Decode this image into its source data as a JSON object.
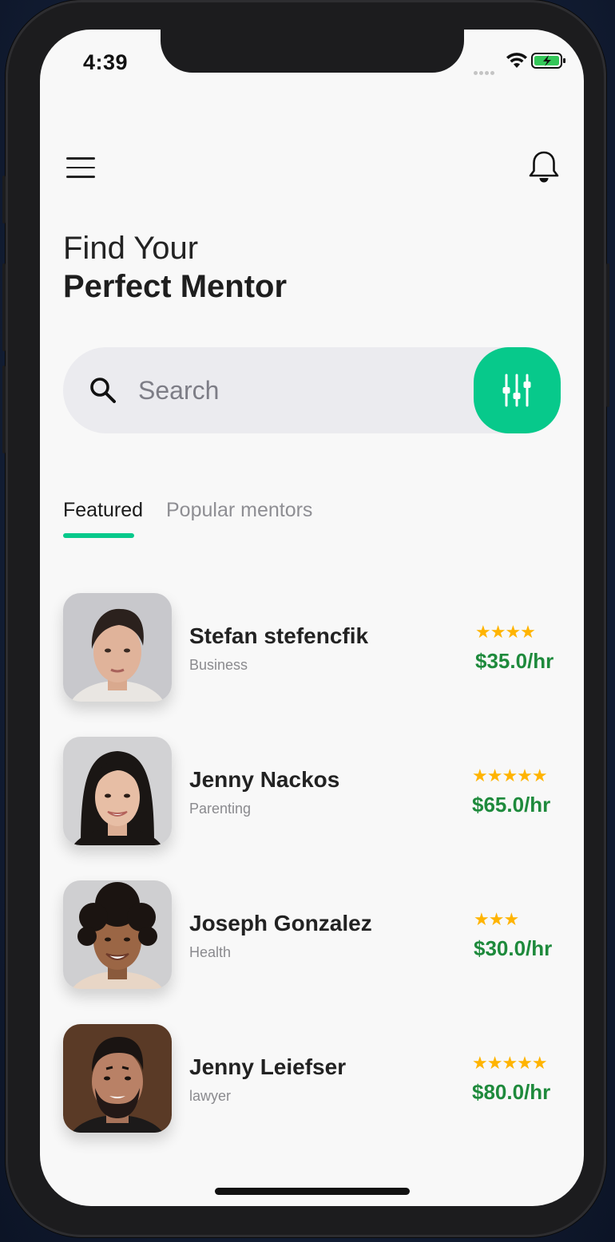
{
  "status_bar": {
    "time": "4:39"
  },
  "header": {
    "title_line1": "Find Your",
    "title_line2": "Perfect Mentor"
  },
  "search": {
    "placeholder": "Search",
    "value": ""
  },
  "tabs": [
    {
      "label": "Featured",
      "active": true
    },
    {
      "label": "Popular mentors",
      "active": false
    }
  ],
  "mentors": [
    {
      "name": "Stefan stefencfik",
      "category": "Business",
      "stars": "★★★★",
      "rating": 4,
      "price": "$35.0/hr"
    },
    {
      "name": "Jenny Nackos",
      "category": "Parenting",
      "stars": "★★★★★",
      "rating": 5,
      "price": "$65.0/hr"
    },
    {
      "name": "Joseph Gonzalez",
      "category": "Health",
      "stars": "★★★",
      "rating": 3,
      "price": "$30.0/hr"
    },
    {
      "name": "Jenny Leiefser",
      "category": "lawyer",
      "stars": "★★★★★",
      "rating": 5,
      "price": "$80.0/hr"
    }
  ],
  "colors": {
    "accent": "#07c98b",
    "price": "#1e8a3c",
    "star": "#ffb400",
    "background": "#f8f8f8"
  },
  "icons": [
    "menu-icon",
    "bell-icon",
    "search-icon",
    "sliders-icon",
    "wifi-icon",
    "battery-icon"
  ]
}
